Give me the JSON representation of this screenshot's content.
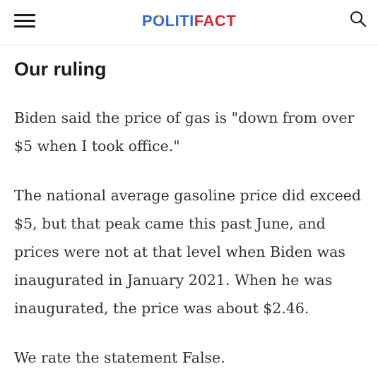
{
  "header": {
    "logo_part_a": "P",
    "logo_part_o": "O",
    "logo_part_b": "LITI",
    "logo_part_c": "FACT",
    "menu_icon": "hamburger-menu-icon",
    "search_icon": "search-icon",
    "logo_colors": {
      "blue": "#2f6bd6",
      "red": "#d3262f",
      "yellow_accent": "#f2c230"
    }
  },
  "article": {
    "heading": "Our ruling",
    "paragraphs": [
      "Biden said the price of gas is \"down from over $5 when I took office.\"",
      "The national average gasoline price did exceed $5, but that peak came this past June, and prices were not at that level when Biden was inaugurated in January 2021. When he was inaugurated, the price was about $2.46.",
      "We rate the statement False."
    ]
  }
}
